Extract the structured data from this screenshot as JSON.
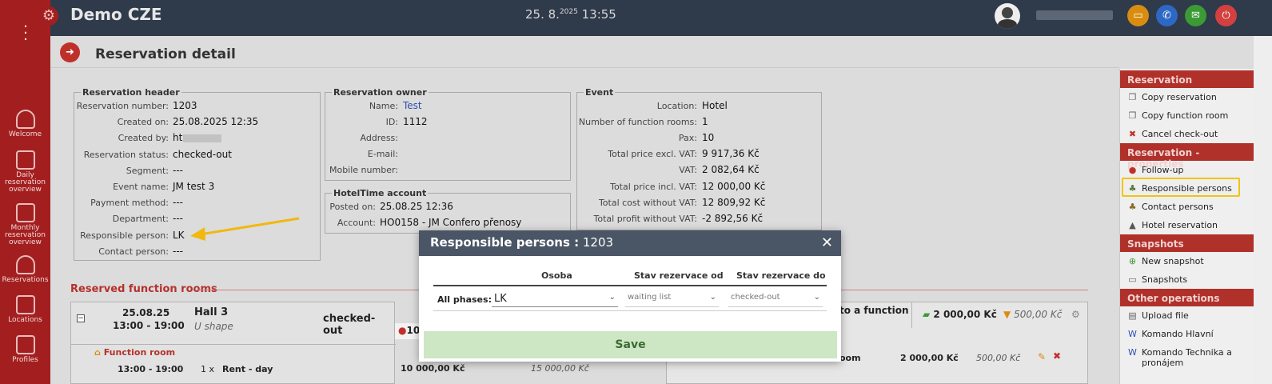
{
  "app": {
    "title": "Demo CZE",
    "date": "25. 8.",
    "year": "2025",
    "time": "13:55"
  },
  "nav": [
    {
      "label": "Welcome",
      "icon": "home-icon"
    },
    {
      "label": "Daily reservation overview",
      "icon": "daily-chart-icon"
    },
    {
      "label": "Monthly reservation overview",
      "icon": "monthly-chart-icon"
    },
    {
      "label": "Reservations",
      "icon": "bell-icon"
    },
    {
      "label": "Locations",
      "icon": "locations-icon"
    },
    {
      "label": "Profiles",
      "icon": "profiles-icon"
    }
  ],
  "page": {
    "title": "Reservation detail"
  },
  "header": {
    "legend": "Reservation header",
    "rows": [
      {
        "k": "Reservation number:",
        "v": "1203"
      },
      {
        "k": "Created on:",
        "v": "25.08.2025 12:35"
      },
      {
        "k": "Created by:",
        "v": "ht"
      },
      {
        "k": "Reservation status:",
        "v": "checked-out"
      },
      {
        "k": "Segment:",
        "v": "---"
      },
      {
        "k": "Event name:",
        "v": "JM test 3"
      },
      {
        "k": "Payment method:",
        "v": "---"
      },
      {
        "k": "Department:",
        "v": "---"
      },
      {
        "k": "Responsible person:",
        "v": "LK"
      },
      {
        "k": "Contact person:",
        "v": "---"
      }
    ]
  },
  "owner": {
    "legend": "Reservation owner",
    "rows": [
      {
        "k": "Name:",
        "v": "Test"
      },
      {
        "k": "ID:",
        "v": "1112"
      },
      {
        "k": "Address:",
        "v": ""
      },
      {
        "k": "E-mail:",
        "v": ""
      },
      {
        "k": "Mobile number:",
        "v": ""
      }
    ]
  },
  "account": {
    "legend": "HotelTime account",
    "rows": [
      {
        "k": "Posted on:",
        "v": "25.08.25 12:36"
      },
      {
        "k": "Account:",
        "v": "HO0158 - JM Confero přenosy"
      }
    ]
  },
  "event": {
    "legend": "Event",
    "rows": [
      {
        "k": "Location:",
        "v": "Hotel"
      },
      {
        "k": "Number of function rooms:",
        "v": "1"
      },
      {
        "k": "Pax:",
        "v": "10"
      },
      {
        "k": "Total price excl. VAT:",
        "v": "9 917,36 Kč"
      },
      {
        "k": "VAT:",
        "v": "2 082,64 Kč"
      },
      {
        "k": "Total price incl. VAT:",
        "v": "12 000,00 Kč"
      },
      {
        "k": "Total cost without VAT:",
        "v": "12 809,92 Kč"
      },
      {
        "k": "Total profit without VAT:",
        "v": "-2 892,56 Kč"
      }
    ]
  },
  "rooms": {
    "title": "Reserved function rooms",
    "date": "25.08.25",
    "time": "13:00 - 19:00",
    "hall": "Hall 3",
    "shape": "U shape",
    "status": "checked-out",
    "pax": "10",
    "sub_title": "Function room",
    "line_time": "13:00 - 19:00",
    "line_qty": "1 x",
    "line_name": "Rent - day",
    "line_price": "10 000,00 Kč",
    "line_price2": "15 000,00 Kč"
  },
  "extras": {
    "header": "to a function",
    "price": "2 000,00 Kč",
    "cost": "500,00 Kč",
    "line_name": "oom",
    "line_price": "2 000,00 Kč",
    "line_cost": "500,00 Kč"
  },
  "right": {
    "sections": [
      {
        "title": "Reservation",
        "items": [
          {
            "label": "Copy reservation",
            "icon": "copy-icon"
          },
          {
            "label": "Copy function room",
            "icon": "copy-icon"
          },
          {
            "label": "Cancel check-out",
            "icon": "cancel-icon"
          }
        ]
      },
      {
        "title": "Reservation - properties",
        "items": [
          {
            "label": "Follow-up",
            "icon": "alert-icon"
          },
          {
            "label": "Responsible persons",
            "icon": "persons-icon"
          },
          {
            "label": "Contact persons",
            "icon": "contacts-icon"
          },
          {
            "label": "Hotel reservation",
            "icon": "hotel-icon"
          }
        ]
      },
      {
        "title": "Snapshots",
        "items": [
          {
            "label": "New snapshot",
            "icon": "add-icon"
          },
          {
            "label": "Snapshots",
            "icon": "snapshot-icon"
          }
        ]
      },
      {
        "title": "Other operations",
        "items": [
          {
            "label": "Upload file",
            "icon": "upload-icon"
          },
          {
            "label": "Komando Hlavní",
            "icon": "word-icon"
          },
          {
            "label": "Komando Technika a",
            "label2": "pronájem",
            "icon": "word-icon"
          }
        ]
      }
    ]
  },
  "modal": {
    "title": "Responsible persons :",
    "number": "1203",
    "col_person": "Osoba",
    "col_from": "Stav rezervace od",
    "col_to": "Stav rezervace do",
    "row_label": "All phases:",
    "person": "LK",
    "from": "waiting list",
    "to": "checked-out",
    "save": "Save"
  },
  "colors": {
    "brand": "#a31f1f",
    "topbar": "#2f3a4b",
    "accent": "#b0302a",
    "highlight": "#f1c40f",
    "save": "#cde6c3"
  }
}
